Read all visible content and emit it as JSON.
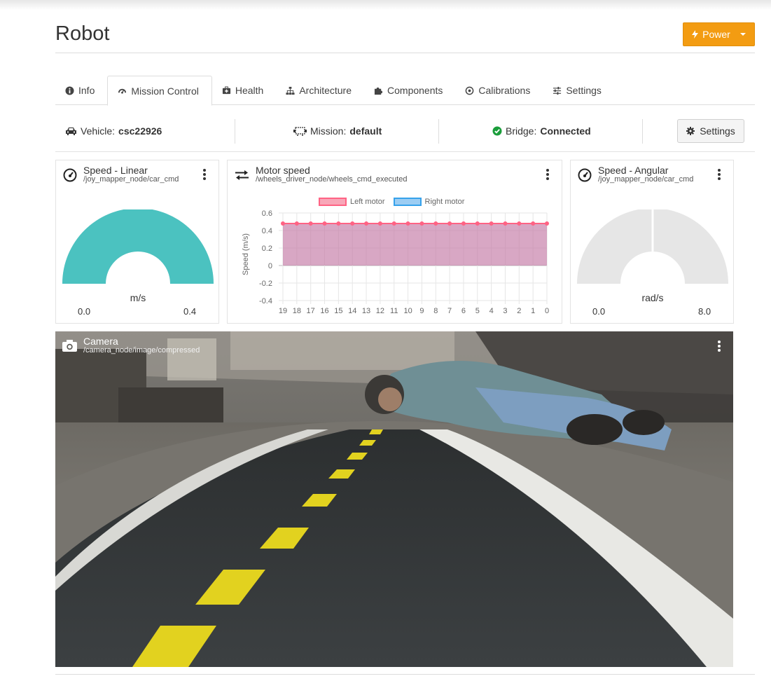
{
  "page": {
    "title": "Robot"
  },
  "power_button": {
    "label": "Power"
  },
  "tabs": [
    {
      "label": "Info",
      "icon": "info-icon"
    },
    {
      "label": "Mission Control",
      "icon": "dashboard-icon",
      "active": true
    },
    {
      "label": "Health",
      "icon": "medkit-icon"
    },
    {
      "label": "Architecture",
      "icon": "sitemap-icon"
    },
    {
      "label": "Components",
      "icon": "puzzle-icon"
    },
    {
      "label": "Calibrations",
      "icon": "target-icon"
    },
    {
      "label": "Settings",
      "icon": "sliders-icon"
    }
  ],
  "status": {
    "vehicle_label": "Vehicle:",
    "vehicle_value": "csc22926",
    "mission_label": "Mission:",
    "mission_value": "default",
    "bridge_label": "Bridge:",
    "bridge_value": "Connected",
    "settings_label": "Settings"
  },
  "speed_linear": {
    "title": "Speed - Linear",
    "topic": "/joy_mapper_node/car_cmd",
    "unit": "m/s",
    "min": "0.0",
    "max": "0.4",
    "fill_fraction": 1.0,
    "color": "#4bc2c0"
  },
  "speed_angular": {
    "title": "Speed - Angular",
    "topic": "/joy_mapper_node/car_cmd",
    "unit": "rad/s",
    "min": "0.0",
    "max": "8.0",
    "fill_fraction": 0.0,
    "color": "#e6e6e6"
  },
  "motor_speed": {
    "title": "Motor speed",
    "topic": "/wheels_driver_node/wheels_cmd_executed"
  },
  "chart_data": {
    "type": "area",
    "x": [
      "19",
      "18",
      "17",
      "16",
      "15",
      "14",
      "13",
      "12",
      "11",
      "10",
      "9",
      "8",
      "7",
      "6",
      "5",
      "4",
      "3",
      "2",
      "1",
      "0"
    ],
    "series": [
      {
        "name": "Left motor",
        "values": [
          0.48,
          0.48,
          0.48,
          0.48,
          0.48,
          0.48,
          0.48,
          0.48,
          0.48,
          0.48,
          0.48,
          0.48,
          0.48,
          0.48,
          0.48,
          0.48,
          0.48,
          0.48,
          0.48,
          0.48
        ],
        "color": "#ff6384"
      },
      {
        "name": "Right motor",
        "values": [
          0.48,
          0.48,
          0.48,
          0.48,
          0.48,
          0.48,
          0.48,
          0.48,
          0.48,
          0.48,
          0.48,
          0.48,
          0.48,
          0.48,
          0.48,
          0.48,
          0.48,
          0.48,
          0.48,
          0.48
        ],
        "color": "#36a2eb"
      }
    ],
    "ylabel": "Speed (m/s)",
    "ylim": [
      -0.4,
      0.6
    ],
    "yticks": [
      "0.6",
      "0.4",
      "0.2",
      "0",
      "-0.2",
      "-0.4"
    ],
    "grid": true,
    "legend": "top"
  },
  "camera": {
    "title": "Camera",
    "topic": "/camera_node/image/compressed"
  }
}
